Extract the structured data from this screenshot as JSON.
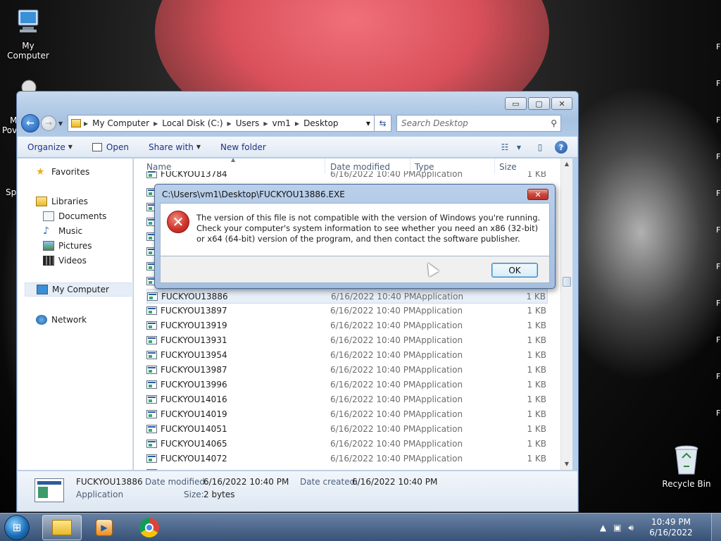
{
  "desktop": {
    "icons": [
      {
        "label": "My Computer"
      },
      {
        "label": "Recycle Bin"
      }
    ],
    "partial_labels": [
      "M",
      "Pov",
      "Spy"
    ],
    "right_edge_marks": [
      "F",
      "F",
      "F",
      "F",
      "F",
      "F",
      "F",
      "F",
      "F",
      "F",
      "F"
    ]
  },
  "explorer": {
    "window_controls": {
      "minimize": "▭",
      "maximize": "▢",
      "close": "✕"
    },
    "breadcrumb": [
      "My Computer",
      "Local Disk (C:)",
      "Users",
      "vm1",
      "Desktop"
    ],
    "search_placeholder": "Search Desktop",
    "toolbar": {
      "organize": "Organize",
      "open": "Open",
      "share_with": "Share with",
      "new_folder": "New folder"
    },
    "nav": {
      "favorites": "Favorites",
      "libraries": "Libraries",
      "documents": "Documents",
      "music": "Music",
      "pictures": "Pictures",
      "videos": "Videos",
      "my_computer": "My Computer",
      "network": "Network"
    },
    "columns": {
      "name": "Name",
      "date": "Date modified",
      "type": "Type",
      "size": "Size"
    },
    "files": [
      {
        "name": "FUCKYOU13784",
        "date": "6/16/2022 10:40 PM",
        "type": "Application",
        "size": "1 KB"
      },
      {
        "name": "FUCKYOU13886",
        "date": "6/16/2022 10:40 PM",
        "type": "Application",
        "size": "1 KB"
      },
      {
        "name": "FUCKYOU13897",
        "date": "6/16/2022 10:40 PM",
        "type": "Application",
        "size": "1 KB"
      },
      {
        "name": "FUCKYOU13919",
        "date": "6/16/2022 10:40 PM",
        "type": "Application",
        "size": "1 KB"
      },
      {
        "name": "FUCKYOU13931",
        "date": "6/16/2022 10:40 PM",
        "type": "Application",
        "size": "1 KB"
      },
      {
        "name": "FUCKYOU13954",
        "date": "6/16/2022 10:40 PM",
        "type": "Application",
        "size": "1 KB"
      },
      {
        "name": "FUCKYOU13987",
        "date": "6/16/2022 10:40 PM",
        "type": "Application",
        "size": "1 KB"
      },
      {
        "name": "FUCKYOU13996",
        "date": "6/16/2022 10:40 PM",
        "type": "Application",
        "size": "1 KB"
      },
      {
        "name": "FUCKYOU14016",
        "date": "6/16/2022 10:40 PM",
        "type": "Application",
        "size": "1 KB"
      },
      {
        "name": "FUCKYOU14019",
        "date": "6/16/2022 10:40 PM",
        "type": "Application",
        "size": "1 KB"
      },
      {
        "name": "FUCKYOU14051",
        "date": "6/16/2022 10:40 PM",
        "type": "Application",
        "size": "1 KB"
      },
      {
        "name": "FUCKYOU14065",
        "date": "6/16/2022 10:40 PM",
        "type": "Application",
        "size": "1 KB"
      },
      {
        "name": "FUCKYOU14072",
        "date": "6/16/2022 10:40 PM",
        "type": "Application",
        "size": "1 KB"
      }
    ],
    "details": {
      "name": "FUCKYOU13886",
      "type": "Application",
      "date_modified_label": "Date modified:",
      "date_modified": "6/16/2022 10:40 PM",
      "date_created_label": "Date created:",
      "date_created": "6/16/2022 10:40 PM",
      "size_label": "Size:",
      "size": "2 bytes"
    }
  },
  "dialog": {
    "title": "C:\\Users\\vm1\\Desktop\\FUCKYOU13886.EXE",
    "close": "✕",
    "icon": "error-icon",
    "message": "The version of this file is not compatible with the version of Windows you're running. Check your computer's system information to see whether you need an x86 (32-bit) or x64 (64-bit) version of the program, and then contact the software publisher.",
    "ok": "OK"
  },
  "taskbar": {
    "apps": [
      "windows-explorer",
      "windows-media-player",
      "google-chrome"
    ],
    "time": "10:49 PM",
    "date": "6/16/2022"
  },
  "colors": {
    "accent": "#1f5fb6",
    "error": "#d0342b"
  }
}
